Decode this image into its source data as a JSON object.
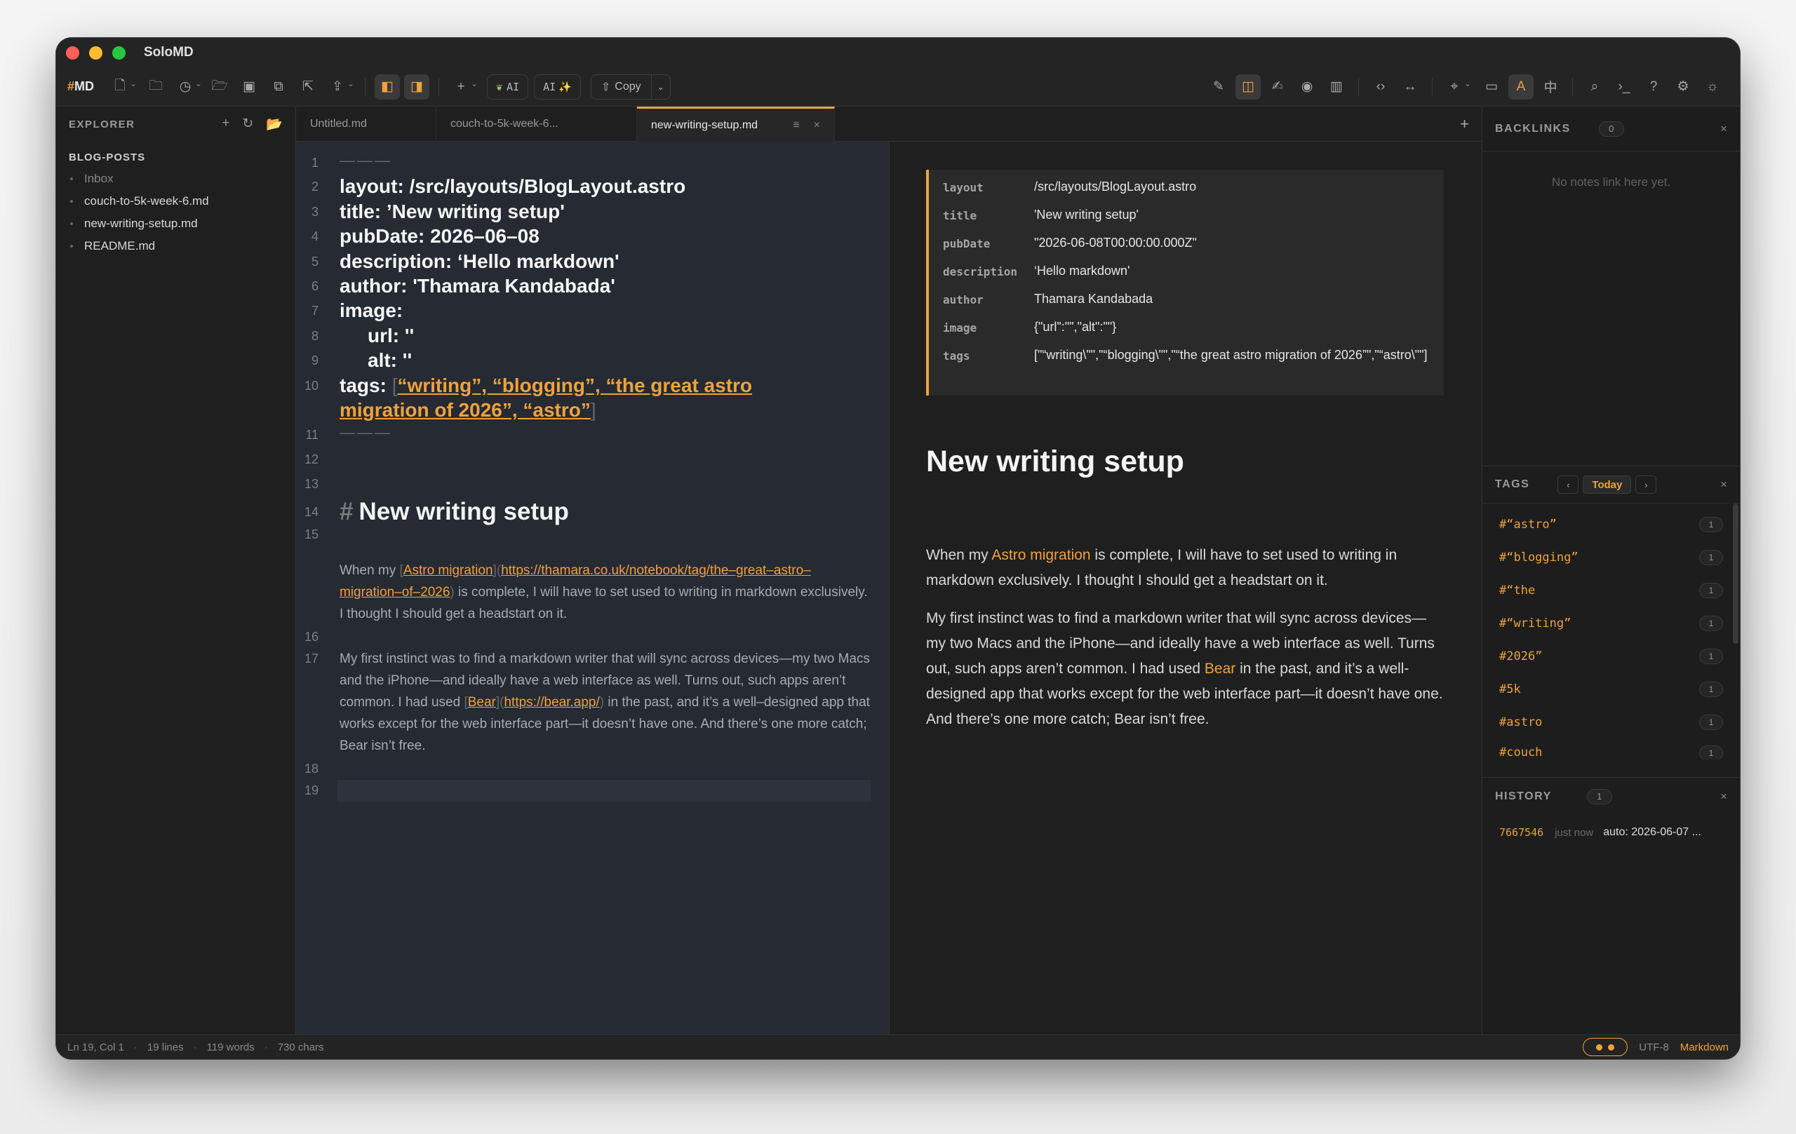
{
  "app": {
    "title": "SoloMD"
  },
  "toolbar": {
    "brand_prefix": "#",
    "brand_text": "MD",
    "ai_label": "AI",
    "ai_spark_label": "AI",
    "copy_label": "Copy"
  },
  "sidebar": {
    "title": "EXPLORER",
    "folder": "BLOG-POSTS",
    "items": [
      {
        "label": "Inbox"
      },
      {
        "label": "couch-to-5k-week-6.md"
      },
      {
        "label": "new-writing-setup.md"
      },
      {
        "label": "README.md"
      }
    ]
  },
  "tabs": [
    {
      "label": "Untitled.md"
    },
    {
      "label": "couch-to-5k-week-6..."
    },
    {
      "label": "new-writing-setup.md"
    }
  ],
  "editor": {
    "line_numbers": [
      "1",
      "2",
      "3",
      "4",
      "5",
      "6",
      "7",
      "8",
      "9",
      "10",
      "11",
      "12",
      "13",
      "14",
      "15",
      "16",
      "17",
      "18",
      "19"
    ],
    "hr_top": "———",
    "fm_layout": "layout: /src/layouts/BlogLayout.astro",
    "fm_title": "title: ’New writing setup'",
    "fm_pubdate": "pubDate: 2026–06–08",
    "fm_description": "description: ‘Hello markdown'",
    "fm_author": "author: 'Thamara Kandabada'",
    "fm_image": "image:",
    "fm_url": "url: ''",
    "fm_alt": "alt: ''",
    "fm_tags_key": "tags: ",
    "fm_tags_open": "[",
    "fm_tags_line1": "“writing”, “blogging”, “the great astro",
    "fm_tags_line2": "migration of 2026”, “astro”",
    "fm_tags_close": "]",
    "hr_bottom": "———",
    "heading_hash": "#",
    "heading": "New writing setup",
    "p1_a": "When my ",
    "p1_link_text": "Astro migration",
    "p1_link_url": "https://thamara.co.uk/notebook/tag/the–great–astro–migration–of–2026",
    "p1_b": " is complete, I will have to set used to writing in markdown exclusively. I thought I should get a headstart on it.",
    "p2_a": "My first instinct was to find a markdown writer that will sync across devices—my two Macs and the iPhone—and ideally have a web interface as well. Turns out, such apps aren’t common. I had used ",
    "p2_link_text": "Bear",
    "p2_link_url": "https://bear.app/",
    "p2_b": " in the past, and it’s a well–designed app that works except for the web interface part—it doesn’t have one. And there’s one more catch; Bear isn’t free."
  },
  "preview": {
    "frontmatter": [
      {
        "key": "layout",
        "value": "/src/layouts/BlogLayout.astro"
      },
      {
        "key": "title",
        "value": "'New writing setup'"
      },
      {
        "key": "pubDate",
        "value": "\"2026-06-08T00:00:00.000Z\""
      },
      {
        "key": "description",
        "value": "‘Hello markdown'"
      },
      {
        "key": "author",
        "value": "Thamara Kandabada"
      },
      {
        "key": "image",
        "value": "{\"url\":\"\",\"alt\":\"\"}"
      },
      {
        "key": "tags",
        "value": "[\"“writing\\\"\",\"“blogging\\\"\",\"“the great astro migration of 2026”\",\"“astro\\\"\"]"
      }
    ],
    "heading": "New writing setup",
    "p1_a": "When my ",
    "p1_link": "Astro migration",
    "p1_b": " is complete, I will have to set used to writing in markdown exclusively. I thought I should get a headstart on it.",
    "p2_a": "My first instinct was to find a markdown writer that will sync across devices—my two Macs and the iPhone—and ideally have a web interface as well. Turns out, such apps aren’t common. I had used ",
    "p2_link": "Bear",
    "p2_b": " in the past, and it’s a well-designed app that works except for the web interface part—it doesn’t have one. And there’s one more catch; Bear isn’t free."
  },
  "backlinks": {
    "title": "BACKLINKS",
    "count": "0",
    "empty": "No notes link here yet."
  },
  "tags_panel": {
    "title": "TAGS",
    "today": "Today",
    "items": [
      {
        "name": "#“astro”",
        "count": "1"
      },
      {
        "name": "#“blogging”",
        "count": "1"
      },
      {
        "name": "#“the",
        "count": "1"
      },
      {
        "name": "#“writing”",
        "count": "1"
      },
      {
        "name": "#2026”",
        "count": "1"
      },
      {
        "name": "#5k",
        "count": "1"
      },
      {
        "name": "#astro",
        "count": "1"
      },
      {
        "name": "#couch",
        "count": "1"
      }
    ]
  },
  "history": {
    "title": "HISTORY",
    "count": "1",
    "items": [
      {
        "hash": "7667546",
        "when": "just now",
        "message": "auto: 2026-06-07 ..."
      }
    ]
  },
  "status": {
    "position": "Ln 19, Col 1",
    "lines": "19 lines",
    "words": "119 words",
    "chars": "730 chars",
    "encoding": "UTF-8",
    "language": "Markdown"
  },
  "colors": {
    "accent": "#f0a23b",
    "editor_bg": "#252a33",
    "panel_bg": "#1f1f1f"
  }
}
